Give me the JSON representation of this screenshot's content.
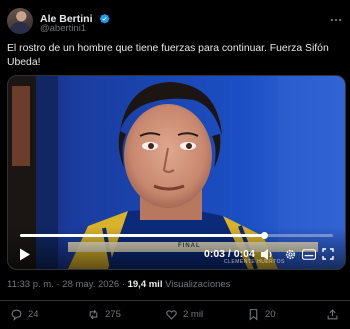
{
  "author": {
    "name": "Ale Bertini",
    "handle": "@abertini1"
  },
  "tweet": {
    "text": "El rostro de un hombre que tiene fuerzas para continuar. Fuerza Sifón Ubeda!"
  },
  "video": {
    "time": "0:03 / 0:04",
    "progress": 0.78,
    "banner_text": "FINAL",
    "watermark": "CLEMENTE HUERTOS"
  },
  "meta": {
    "time": "11:33 p. m.",
    "separator": "·",
    "date": "28 may. 2026",
    "views_count": "19,4 mil",
    "views_label": "Visualizaciones"
  },
  "actions": {
    "replies": "24",
    "reposts": "275",
    "likes": "2 mil",
    "bookmarks": "20"
  },
  "colors": {
    "background": "#000000",
    "text": "#e7e9ea",
    "muted": "#71767b",
    "verified": "#1d9bf0"
  }
}
